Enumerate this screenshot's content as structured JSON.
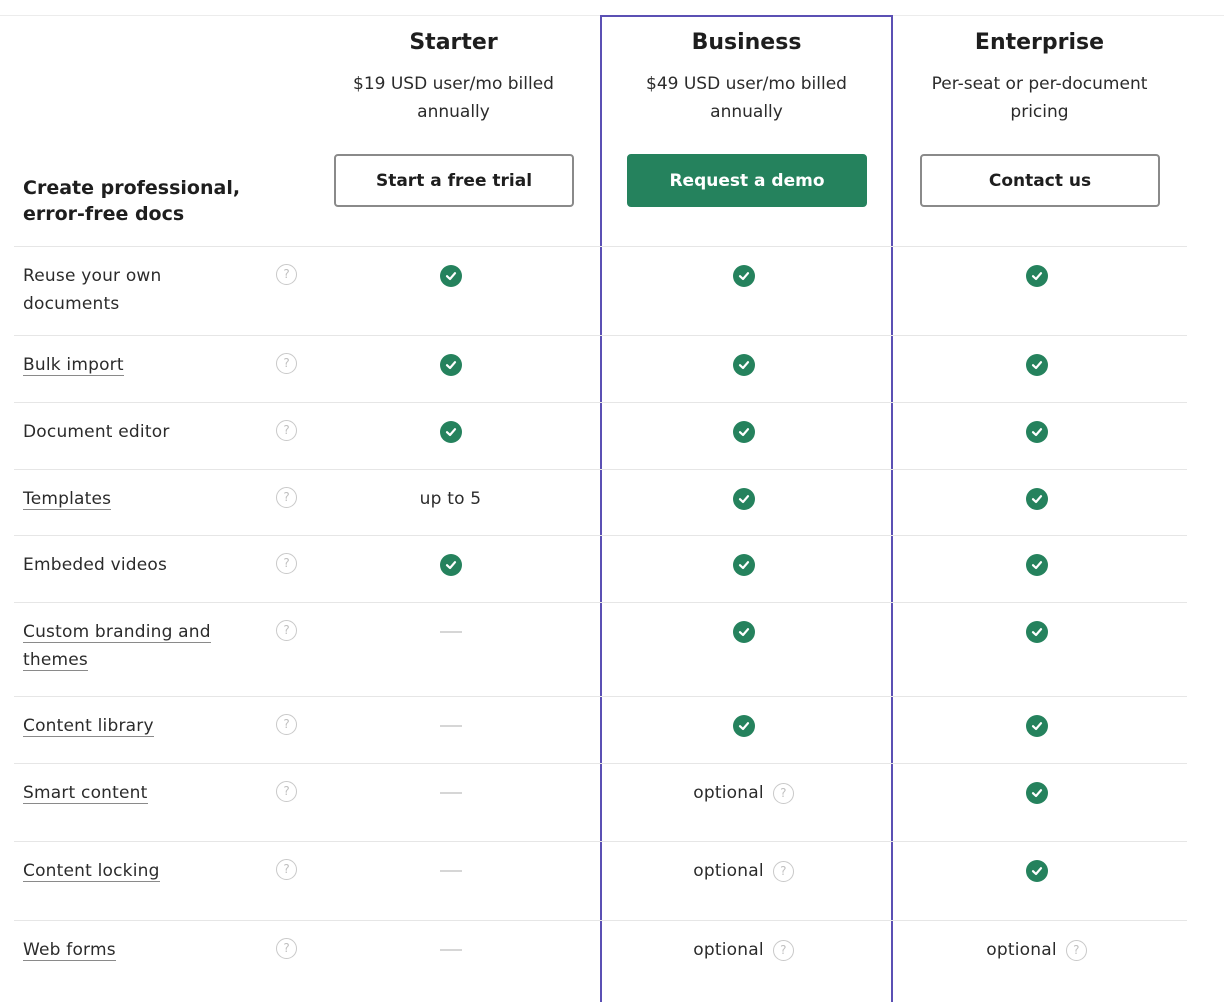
{
  "section_title": "Create professional, error-free docs",
  "help_glyph": "?",
  "colors": {
    "accent": "#25825d",
    "highlight_border": "#5b50b4"
  },
  "plans": [
    {
      "name": "Starter",
      "price": "$19 USD user/mo billed annually",
      "cta": "Start a free trial",
      "primary": false
    },
    {
      "name": "Business",
      "price": "$49 USD user/mo billed annually",
      "cta": "Request a demo",
      "primary": true
    },
    {
      "name": "Enterprise",
      "price": "Per-seat or per-document pricing",
      "cta": "Contact us",
      "primary": false
    }
  ],
  "features": [
    {
      "label": "Reuse your own documents",
      "link": false,
      "starter": "check",
      "business": "check",
      "enterprise": "check"
    },
    {
      "label": "Bulk import",
      "link": true,
      "starter": "check",
      "business": "check",
      "enterprise": "check"
    },
    {
      "label": "Document editor",
      "link": false,
      "starter": "check",
      "business": "check",
      "enterprise": "check"
    },
    {
      "label": "Templates",
      "link": true,
      "starter": "up to 5",
      "business": "check",
      "enterprise": "check"
    },
    {
      "label": "Embeded videos",
      "link": false,
      "starter": "check",
      "business": "check",
      "enterprise": "check"
    },
    {
      "label": "Custom branding and themes",
      "link": true,
      "starter": "dash",
      "business": "check",
      "enterprise": "check"
    },
    {
      "label": "Content library",
      "link": true,
      "starter": "dash",
      "business": "check",
      "enterprise": "check"
    },
    {
      "label": "Smart content",
      "link": true,
      "starter": "dash",
      "business": "optional",
      "enterprise": "check"
    },
    {
      "label": "Content locking",
      "link": true,
      "starter": "dash",
      "business": "optional",
      "enterprise": "check"
    },
    {
      "label": "Web forms",
      "link": true,
      "starter": "dash",
      "business": "optional",
      "enterprise": "optional"
    }
  ]
}
